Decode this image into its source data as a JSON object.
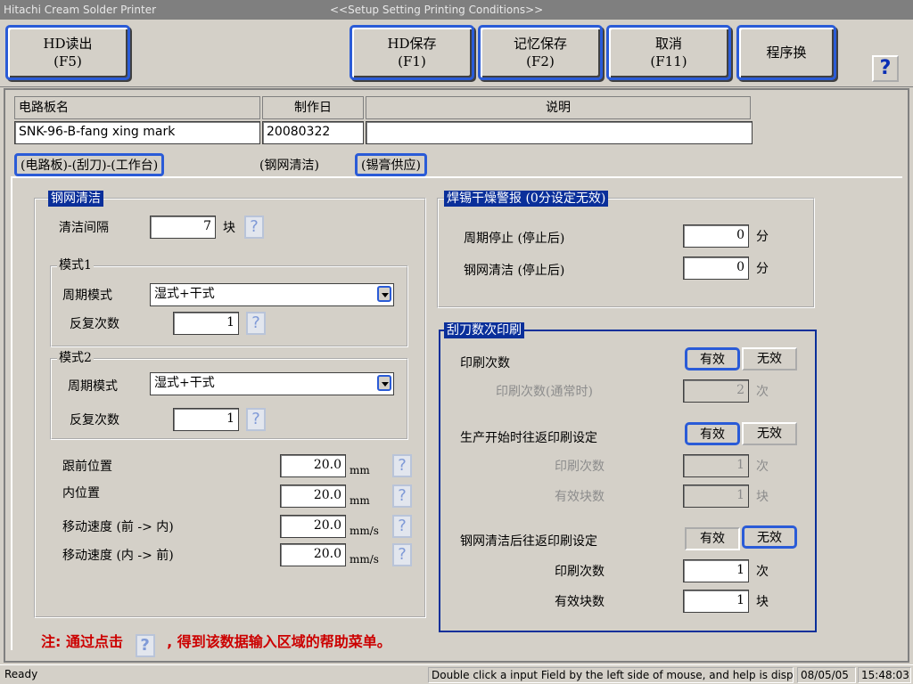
{
  "window": {
    "app_title": "Hitachi Cream Solder Printer",
    "screen_title": "<<Setup Setting Printing Conditions>>"
  },
  "toolbar": {
    "hd_read": {
      "line1": "HD读出",
      "line2": "(F5)"
    },
    "hd_save": {
      "line1": "HD保存",
      "line2": "(F1)"
    },
    "mem_save": {
      "line1": "记忆保存",
      "line2": "(F2)"
    },
    "cancel": {
      "line1": "取消",
      "line2": "(F11)"
    },
    "program_switch": "程序换",
    "help": "?"
  },
  "header": {
    "board_name_label": "电路板名",
    "date_label": "制作日",
    "desc_label": "说明",
    "board_name": "SNK-96-B-fang xing mark",
    "date": "20080322",
    "desc": ""
  },
  "tabs": [
    "(电路板)-(刮刀)-(工作台)",
    "(钢网清洁)",
    "(锡膏供应)"
  ],
  "cleaning": {
    "title": "钢网清洁",
    "interval_label": "清洁间隔",
    "interval_value": "7",
    "interval_unit": "块",
    "mode1": {
      "title": "模式1",
      "cycle_label": "周期模式",
      "cycle_value": "湿式+干式",
      "repeat_label": "反复次数",
      "repeat_value": "1"
    },
    "mode2": {
      "title": "模式2",
      "cycle_label": "周期模式",
      "cycle_value": "湿式+干式",
      "repeat_label": "反复次数",
      "repeat_value": "1"
    },
    "follow_pos_label": "跟前位置",
    "follow_pos_value": "20.0",
    "follow_pos_unit": "mm",
    "inner_pos_label": "内位置",
    "inner_pos_value": "20.0",
    "inner_pos_unit": "mm",
    "speed_fwd_label": "移动速度 (前  -> 内)",
    "speed_fwd_value": "20.0",
    "speed_fwd_unit": "mm/s",
    "speed_back_label": "移动速度 (内  -> 前)",
    "speed_back_value": "20.0",
    "speed_back_unit": "mm/s"
  },
  "dry_alarm": {
    "title": "焊锡干燥警报 (0分设定无效)",
    "cycle_stop_label": "周期停止 (停止后)",
    "cycle_stop_value": "0",
    "cycle_stop_unit": "分",
    "clean_label": "钢网清洁 (停止后)",
    "clean_value": "0",
    "clean_unit": "分"
  },
  "squeegee": {
    "title": "刮刀数次印刷",
    "print_count_label": "印刷次数",
    "valid": "有效",
    "invalid": "无效",
    "normal_count_label": "印刷次数(通常时)",
    "normal_count_value": "2",
    "count_unit": "次",
    "start_label": "生产开始时往返印刷设定",
    "start_count_label": "印刷次数",
    "start_count_value": "1",
    "start_blocks_label": "有效块数",
    "start_blocks_value": "1",
    "block_unit": "块",
    "after_clean_label": "钢网清洁后往返印刷设定",
    "after_count_label": "印刷次数",
    "after_count_value": "1",
    "after_blocks_label": "有效块数",
    "after_blocks_value": "1"
  },
  "note": {
    "prefix": "注: 通过点击",
    "q": "?",
    "suffix": ", 得到该数据输入区域的帮助菜单。"
  },
  "statusbar": {
    "status": "Ready",
    "hint": "Double click a input Field by the left side of mouse, and help is displayed.",
    "date": "08/05/05",
    "time": "15:48:03"
  }
}
